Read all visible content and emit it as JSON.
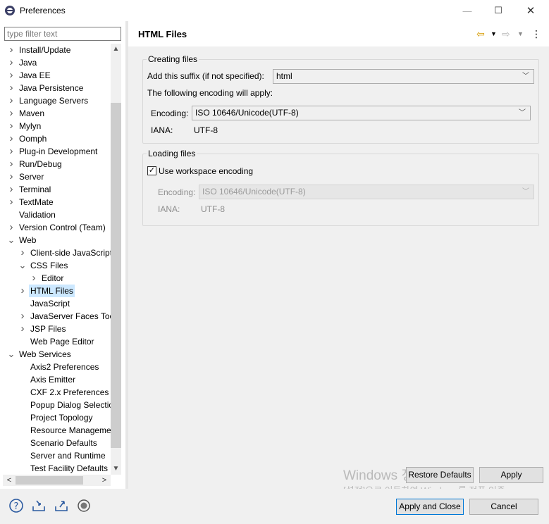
{
  "window": {
    "title": "Preferences"
  },
  "filter": {
    "placeholder": "type filter text"
  },
  "tree": [
    {
      "label": "Install/Update",
      "arrow": ">"
    },
    {
      "label": "Java",
      "arrow": ">"
    },
    {
      "label": "Java EE",
      "arrow": ">"
    },
    {
      "label": "Java Persistence",
      "arrow": ">"
    },
    {
      "label": "Language Servers",
      "arrow": ">"
    },
    {
      "label": "Maven",
      "arrow": ">"
    },
    {
      "label": "Mylyn",
      "arrow": ">"
    },
    {
      "label": "Oomph",
      "arrow": ">"
    },
    {
      "label": "Plug-in Development",
      "arrow": ">"
    },
    {
      "label": "Run/Debug",
      "arrow": ">"
    },
    {
      "label": "Server",
      "arrow": ">"
    },
    {
      "label": "Terminal",
      "arrow": ">"
    },
    {
      "label": "TextMate",
      "arrow": ">"
    },
    {
      "label": "Validation",
      "arrow": ""
    },
    {
      "label": "Version Control (Team)",
      "arrow": ">"
    },
    {
      "label": "Web",
      "arrow": "v"
    },
    {
      "label": "Client-side JavaScript",
      "arrow": ">"
    },
    {
      "label": "CSS Files",
      "arrow": "v"
    },
    {
      "label": "Editor",
      "arrow": ">"
    },
    {
      "label": "HTML Files",
      "arrow": ">"
    },
    {
      "label": "JavaScript",
      "arrow": ""
    },
    {
      "label": "JavaServer Faces Tools",
      "arrow": ">"
    },
    {
      "label": "JSP Files",
      "arrow": ">"
    },
    {
      "label": "Web Page Editor",
      "arrow": ""
    },
    {
      "label": "Web Services",
      "arrow": "v"
    },
    {
      "label": "Axis2 Preferences",
      "arrow": ""
    },
    {
      "label": "Axis Emitter",
      "arrow": ""
    },
    {
      "label": "CXF 2.x Preferences",
      "arrow": ""
    },
    {
      "label": "Popup Dialog Selection",
      "arrow": ""
    },
    {
      "label": "Project Topology",
      "arrow": ""
    },
    {
      "label": "Resource Management",
      "arrow": ""
    },
    {
      "label": "Scenario Defaults",
      "arrow": ""
    },
    {
      "label": "Server and Runtime",
      "arrow": ""
    },
    {
      "label": "Test Facility Defaults",
      "arrow": ""
    }
  ],
  "page": {
    "title": "HTML Files"
  },
  "creating": {
    "legend": "Creating files",
    "suffix_label": "Add this suffix (if not specified):",
    "suffix_value": "html",
    "encoding_note": "The following encoding will apply:",
    "encoding_label": "Encoding:",
    "encoding_value": "ISO 10646/Unicode(UTF-8)",
    "iana_label": "IANA:",
    "iana_value": "UTF-8"
  },
  "loading": {
    "legend": "Loading files",
    "workspace_label": "Use workspace encoding",
    "workspace_checked": true,
    "encoding_label": "Encoding:",
    "encoding_value": "ISO 10646/Unicode(UTF-8)",
    "iana_label": "IANA:",
    "iana_value": "UTF-8"
  },
  "buttons": {
    "restore": "Restore Defaults",
    "apply": "Apply",
    "apply_close": "Apply and Close",
    "cancel": "Cancel"
  },
  "watermark": {
    "line1": "Windows 정품 인증",
    "line2": "[설정]으로 이동하여 Windows를 정품 인증"
  }
}
